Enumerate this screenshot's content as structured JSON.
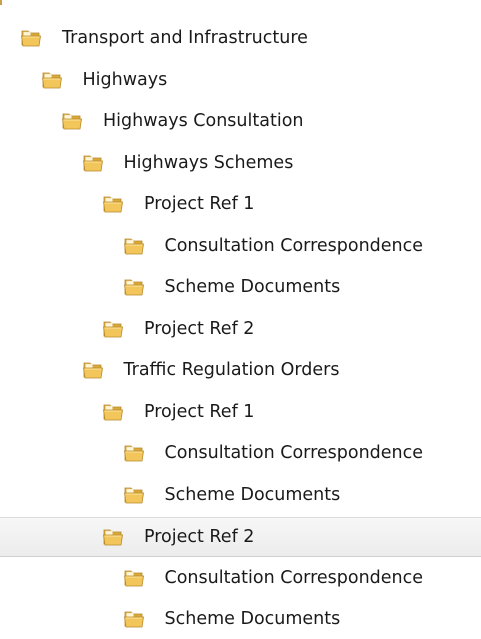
{
  "tree": {
    "items": [
      {
        "label": "Transport and Infrastructure",
        "level": 0,
        "selected": false
      },
      {
        "label": "Highways",
        "level": 1,
        "selected": false
      },
      {
        "label": "Highways Consultation",
        "level": 2,
        "selected": false
      },
      {
        "label": "Highways Schemes",
        "level": 3,
        "selected": false
      },
      {
        "label": "Project Ref 1",
        "level": 4,
        "selected": false
      },
      {
        "label": "Consultation Correspondence",
        "level": 5,
        "selected": false
      },
      {
        "label": "Scheme Documents",
        "level": 5,
        "selected": false
      },
      {
        "label": "Project Ref 2",
        "level": 4,
        "selected": false
      },
      {
        "label": "Traffic Regulation Orders",
        "level": 3,
        "selected": false
      },
      {
        "label": "Project Ref 1",
        "level": 4,
        "selected": false
      },
      {
        "label": "Consultation Correspondence",
        "level": 5,
        "selected": false
      },
      {
        "label": "Scheme Documents",
        "level": 5,
        "selected": false
      },
      {
        "label": "Project Ref 2",
        "level": 4,
        "selected": true
      },
      {
        "label": "Consultation Correspondence",
        "level": 5,
        "selected": false
      },
      {
        "label": "Scheme Documents",
        "level": 5,
        "selected": false
      }
    ]
  },
  "colors": {
    "folder_front": "#f2c65a",
    "folder_back": "#d9a93a",
    "folder_edge": "#b8892a",
    "selected_bg": "#efefef"
  },
  "icons": {
    "folder": "folder-icon"
  }
}
